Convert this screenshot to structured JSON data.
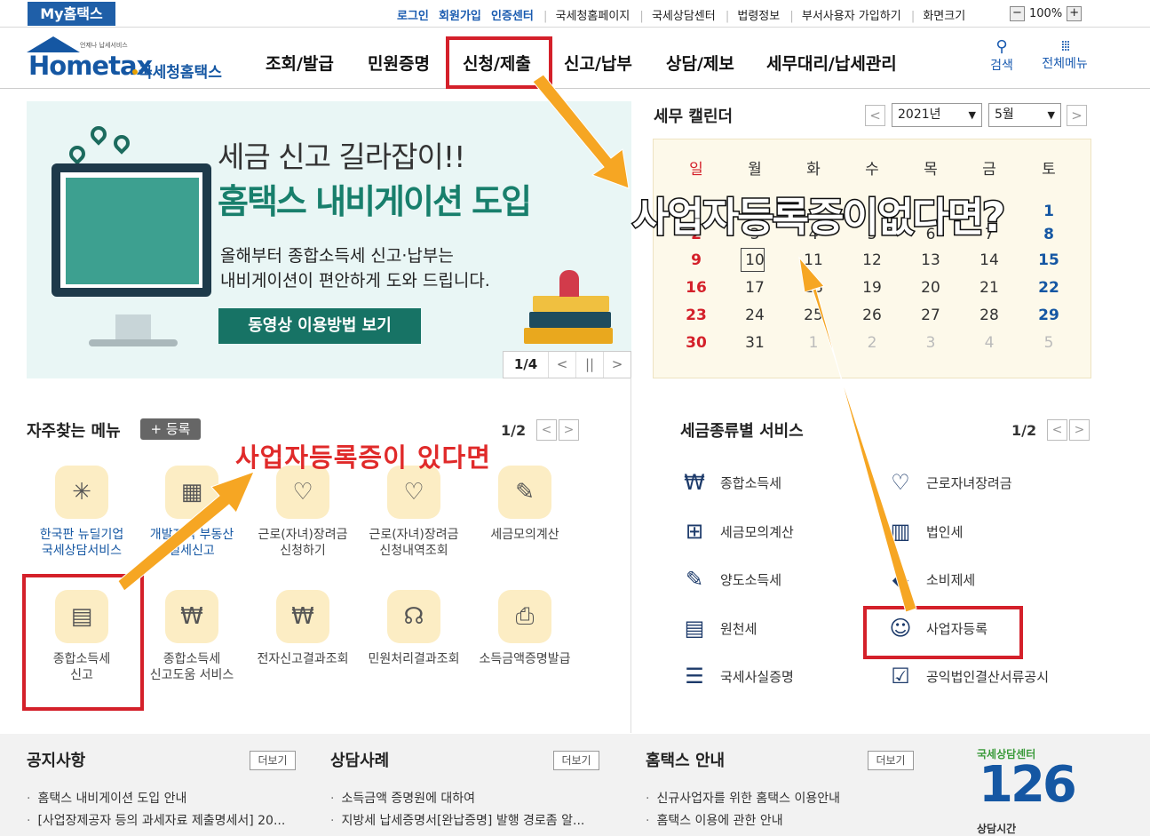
{
  "topbar": {
    "my_hometax": "My홈택스",
    "links": [
      "로그인",
      "회원가입",
      "인증센터",
      "국세청홈페이지",
      "국세상담센터",
      "법령정보",
      "부서사용자 가입하기",
      "화면크기"
    ],
    "zoom_minus": "−",
    "zoom_value": "100%",
    "zoom_plus": "+"
  },
  "header": {
    "logo_small": "언제나 납세서비스",
    "logo_home": "Hometax",
    "logo_kr": "국세청홈택스",
    "nav": [
      "조회/발급",
      "민원증명",
      "신청/제출",
      "신고/납부",
      "상담/제보",
      "세무대리/납세관리"
    ],
    "search_label": "검색",
    "allmenu_label": "전체메뉴"
  },
  "banner": {
    "line1": "세금 신고 길라잡이!!",
    "line2": "홈택스 내비게이션 도입",
    "line3a": "올해부터 종합소득세 신고·납부는",
    "line3b": "내비게이션이 편안하게 도와 드립니다.",
    "button": "동영상 이용방법 보기",
    "pager": "1/4",
    "prev": "<",
    "pause": "||",
    "next": ">"
  },
  "calendar": {
    "title": "세무 캘린더",
    "year": "2021년",
    "month": "5월",
    "prev": "<",
    "next": ">",
    "weekdays": [
      "일",
      "월",
      "화",
      "수",
      "목",
      "금",
      "토"
    ],
    "weeks": [
      [
        "",
        "",
        "",
        "",
        "",
        "",
        "1"
      ],
      [
        "2",
        "3",
        "4",
        "5",
        "6",
        "7",
        "8"
      ],
      [
        "9",
        "10",
        "11",
        "12",
        "13",
        "14",
        "15"
      ],
      [
        "16",
        "17",
        "18",
        "19",
        "20",
        "21",
        "22"
      ],
      [
        "23",
        "24",
        "25",
        "26",
        "27",
        "28",
        "29"
      ],
      [
        "30",
        "31",
        "1",
        "2",
        "3",
        "4",
        "5"
      ]
    ],
    "today": "10"
  },
  "overlays": {
    "no_registration": "사업자등록증이없다면?",
    "has_registration": "사업자등록증이 있다면"
  },
  "favorites": {
    "title": "자주찾는 메뉴",
    "add": "+ 등록",
    "pager": "1/2",
    "prev": "<",
    "next": ">",
    "row1": [
      {
        "l1": "한국판 뉴딜기업",
        "l2": "국세상담서비스",
        "icon": "newdeal-icon",
        "glyph": "✳"
      },
      {
        "l1": "개발지역 부동산",
        "l2": "실세신고",
        "icon": "building-icon",
        "glyph": "▦"
      },
      {
        "l1": "근로(자녀)장려금",
        "l2": "신청하기",
        "icon": "heart-pen-icon",
        "glyph": "♡"
      },
      {
        "l1": "근로(자녀)장려금",
        "l2": "신청내역조회",
        "icon": "heart-search-icon",
        "glyph": "♡"
      },
      {
        "l1": "세금모의계산",
        "l2": "",
        "icon": "calc-doc-icon",
        "glyph": "✎"
      }
    ],
    "row2": [
      {
        "l1": "종합소득세",
        "l2": "신고",
        "icon": "calendar-pen-icon",
        "glyph": "▤"
      },
      {
        "l1": "종합소득세",
        "l2": "신고도움 서비스",
        "icon": "doc-search-icon",
        "glyph": "₩"
      },
      {
        "l1": "전자신고결과조회",
        "l2": "",
        "icon": "result-search-icon",
        "glyph": "₩"
      },
      {
        "l1": "민원처리결과조회",
        "l2": "",
        "icon": "headset-icon",
        "glyph": "☊"
      },
      {
        "l1": "소득금액증명발급",
        "l2": "",
        "icon": "printer-icon",
        "glyph": "⎙"
      }
    ]
  },
  "services": {
    "title": "세금종류별 서비스",
    "pager": "1/2",
    "prev": "<",
    "next": ">",
    "left": [
      {
        "label": "종합소득세",
        "icon": "money-bag-icon",
        "glyph": "₩"
      },
      {
        "label": "세금모의계산",
        "icon": "calculator-icon",
        "glyph": "⊞"
      },
      {
        "label": "양도소득세",
        "icon": "doc-edit-icon",
        "glyph": "✎"
      },
      {
        "label": "원천세",
        "icon": "salary-doc-icon",
        "glyph": "▤"
      },
      {
        "label": "국세사실증명",
        "icon": "document-icon",
        "glyph": "☰"
      }
    ],
    "right": [
      {
        "label": "근로자녀장려금",
        "icon": "heart-icon",
        "glyph": "♡"
      },
      {
        "label": "법인세",
        "icon": "company-icon",
        "glyph": "▥"
      },
      {
        "label": "소비제세",
        "icon": "diamond-icon",
        "glyph": "◆"
      },
      {
        "label": "사업자등록",
        "icon": "person-icon",
        "glyph": "☺"
      },
      {
        "label": "공익법인결산서류공시",
        "icon": "checklist-icon",
        "glyph": "☑"
      }
    ]
  },
  "bottom": {
    "notice_title": "공지사항",
    "notice_items": [
      "홈택스 내비게이션 도입 안내",
      "[사업장제공자 등의 과세자료 제출명세서] 20..."
    ],
    "counsel_title": "상담사례",
    "counsel_items": [
      "소득금액 증명원에 대하여",
      "지방세 납세증명서[완납증명] 발행 경로좀 알..."
    ],
    "guide_title": "홈택스 안내",
    "guide_items": [
      "신규사업자를 위한 홈택스 이용안내",
      "홈택스 이용에 관한 안내"
    ],
    "more": "더보기",
    "cc_top": "국세상담센터",
    "cc_num": "126",
    "cc_bottom": "상담시간"
  },
  "colors": {
    "brand_blue": "#1557a3",
    "highlight_red": "#d4202a",
    "arrow_orange": "#f6a623",
    "banner_green": "#177365"
  }
}
